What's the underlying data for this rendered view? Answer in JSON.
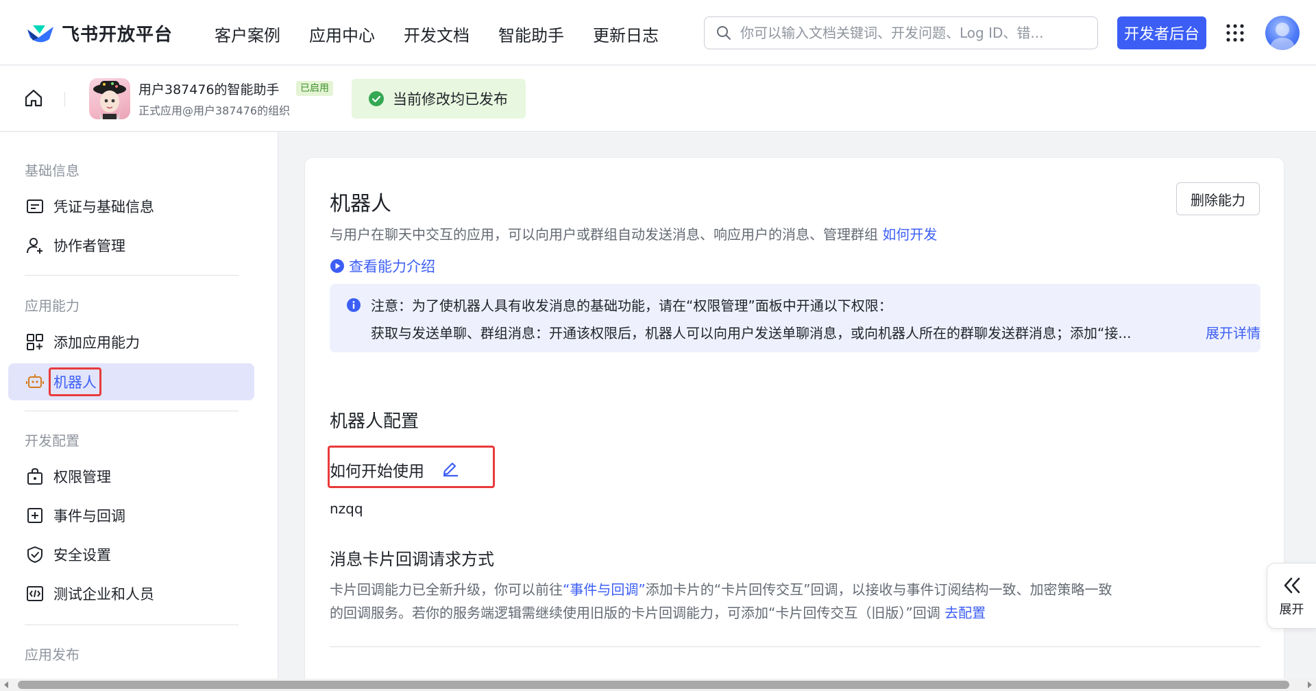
{
  "header": {
    "logo_text": "飞书开放平台",
    "nav": [
      "客户案例",
      "应用中心",
      "开发文档",
      "智能助手",
      "更新日志"
    ],
    "search_placeholder": "你可以输入文档关键词、开发问题、Log ID、错...",
    "dev_console_label": "开发者后台",
    "brand_color": "#3c5ef5"
  },
  "app_bar": {
    "app_name": "用户387476的智能助手",
    "status_badge": "已启用",
    "org": "正式应用@用户387476的组织",
    "publish_status": "当前修改均已发布"
  },
  "sidebar": {
    "groups": [
      {
        "title": "基础信息",
        "items": [
          {
            "label": "凭证与基础信息",
            "icon": "credential-icon"
          },
          {
            "label": "协作者管理",
            "icon": "add-user-icon"
          }
        ]
      },
      {
        "title": "应用能力",
        "items": [
          {
            "label": "添加应用能力",
            "icon": "add-capability-icon"
          },
          {
            "label": "机器人",
            "icon": "robot-icon",
            "active": true
          }
        ]
      },
      {
        "title": "开发配置",
        "items": [
          {
            "label": "权限管理",
            "icon": "lock-icon"
          },
          {
            "label": "事件与回调",
            "icon": "event-icon"
          },
          {
            "label": "安全设置",
            "icon": "shield-icon"
          },
          {
            "label": "测试企业和人员",
            "icon": "code-icon"
          }
        ]
      },
      {
        "title": "应用发布",
        "items": []
      }
    ]
  },
  "main": {
    "title": "机器人",
    "remove_button": "删除能力",
    "description": "与用户在聊天中交互的应用，可以向用户或群组自动发送消息、响应用户的消息、管理群组",
    "how_to_develop": "如何开发",
    "view_intro": "查看能力介绍",
    "notice": {
      "line1": "注意：为了使机器人具有收发消息的基础功能，请在“权限管理”面板中开通以下权限：",
      "line2": "获取与发送单聊、群组消息：开通该权限后，机器人可以向用户发送单聊消息，或向机器人所在的群聊发送群消息；添加“接...",
      "expand": "展开详情"
    },
    "config_title": "机器人配置",
    "how_to_start_label": "如何开始使用",
    "how_to_start_value": "nzqq",
    "callback_title": "消息卡片回调请求方式",
    "callback_desc1_a": "卡片回调能力已全新升级，你可以前往",
    "callback_desc1_link": "“事件与回调”",
    "callback_desc1_b": "添加卡片的“卡片回传交互”回调，以接收与事件订阅结构一致、加密策略一致",
    "callback_desc2": "的回调服务。若你的服务端逻辑需继续使用旧版的卡片回调能力，可添加“卡片回传交互（旧版）”回调",
    "callback_config_link": "去配置"
  },
  "expand_tab": {
    "label": "展开"
  }
}
